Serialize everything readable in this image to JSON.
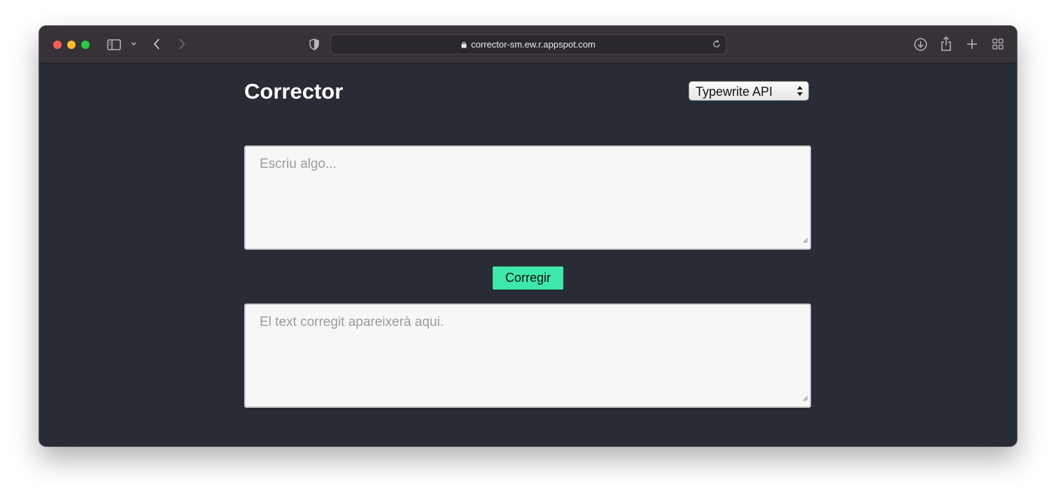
{
  "browser": {
    "url": "corrector-sm.ew.r.appspot.com",
    "traffic_lights": {
      "close": "#fe5f57",
      "minimize": "#febc2e",
      "zoom": "#28c840"
    },
    "icons": [
      "sidebar-icon",
      "chevron-down-icon",
      "back-icon",
      "forward-icon",
      "shield-icon",
      "lock-icon",
      "reload-icon",
      "download-icon",
      "share-icon",
      "new-tab-icon",
      "tab-overview-icon"
    ]
  },
  "app": {
    "title": "Corrector",
    "engine_select": {
      "selected": "Typewrite API"
    },
    "input": {
      "placeholder": "Escriu algo..."
    },
    "button": {
      "label": "Corregir",
      "color": "#3ee8a8"
    },
    "output": {
      "placeholder": "El text corregit apareixerà aqui."
    },
    "background": "#282c35"
  }
}
